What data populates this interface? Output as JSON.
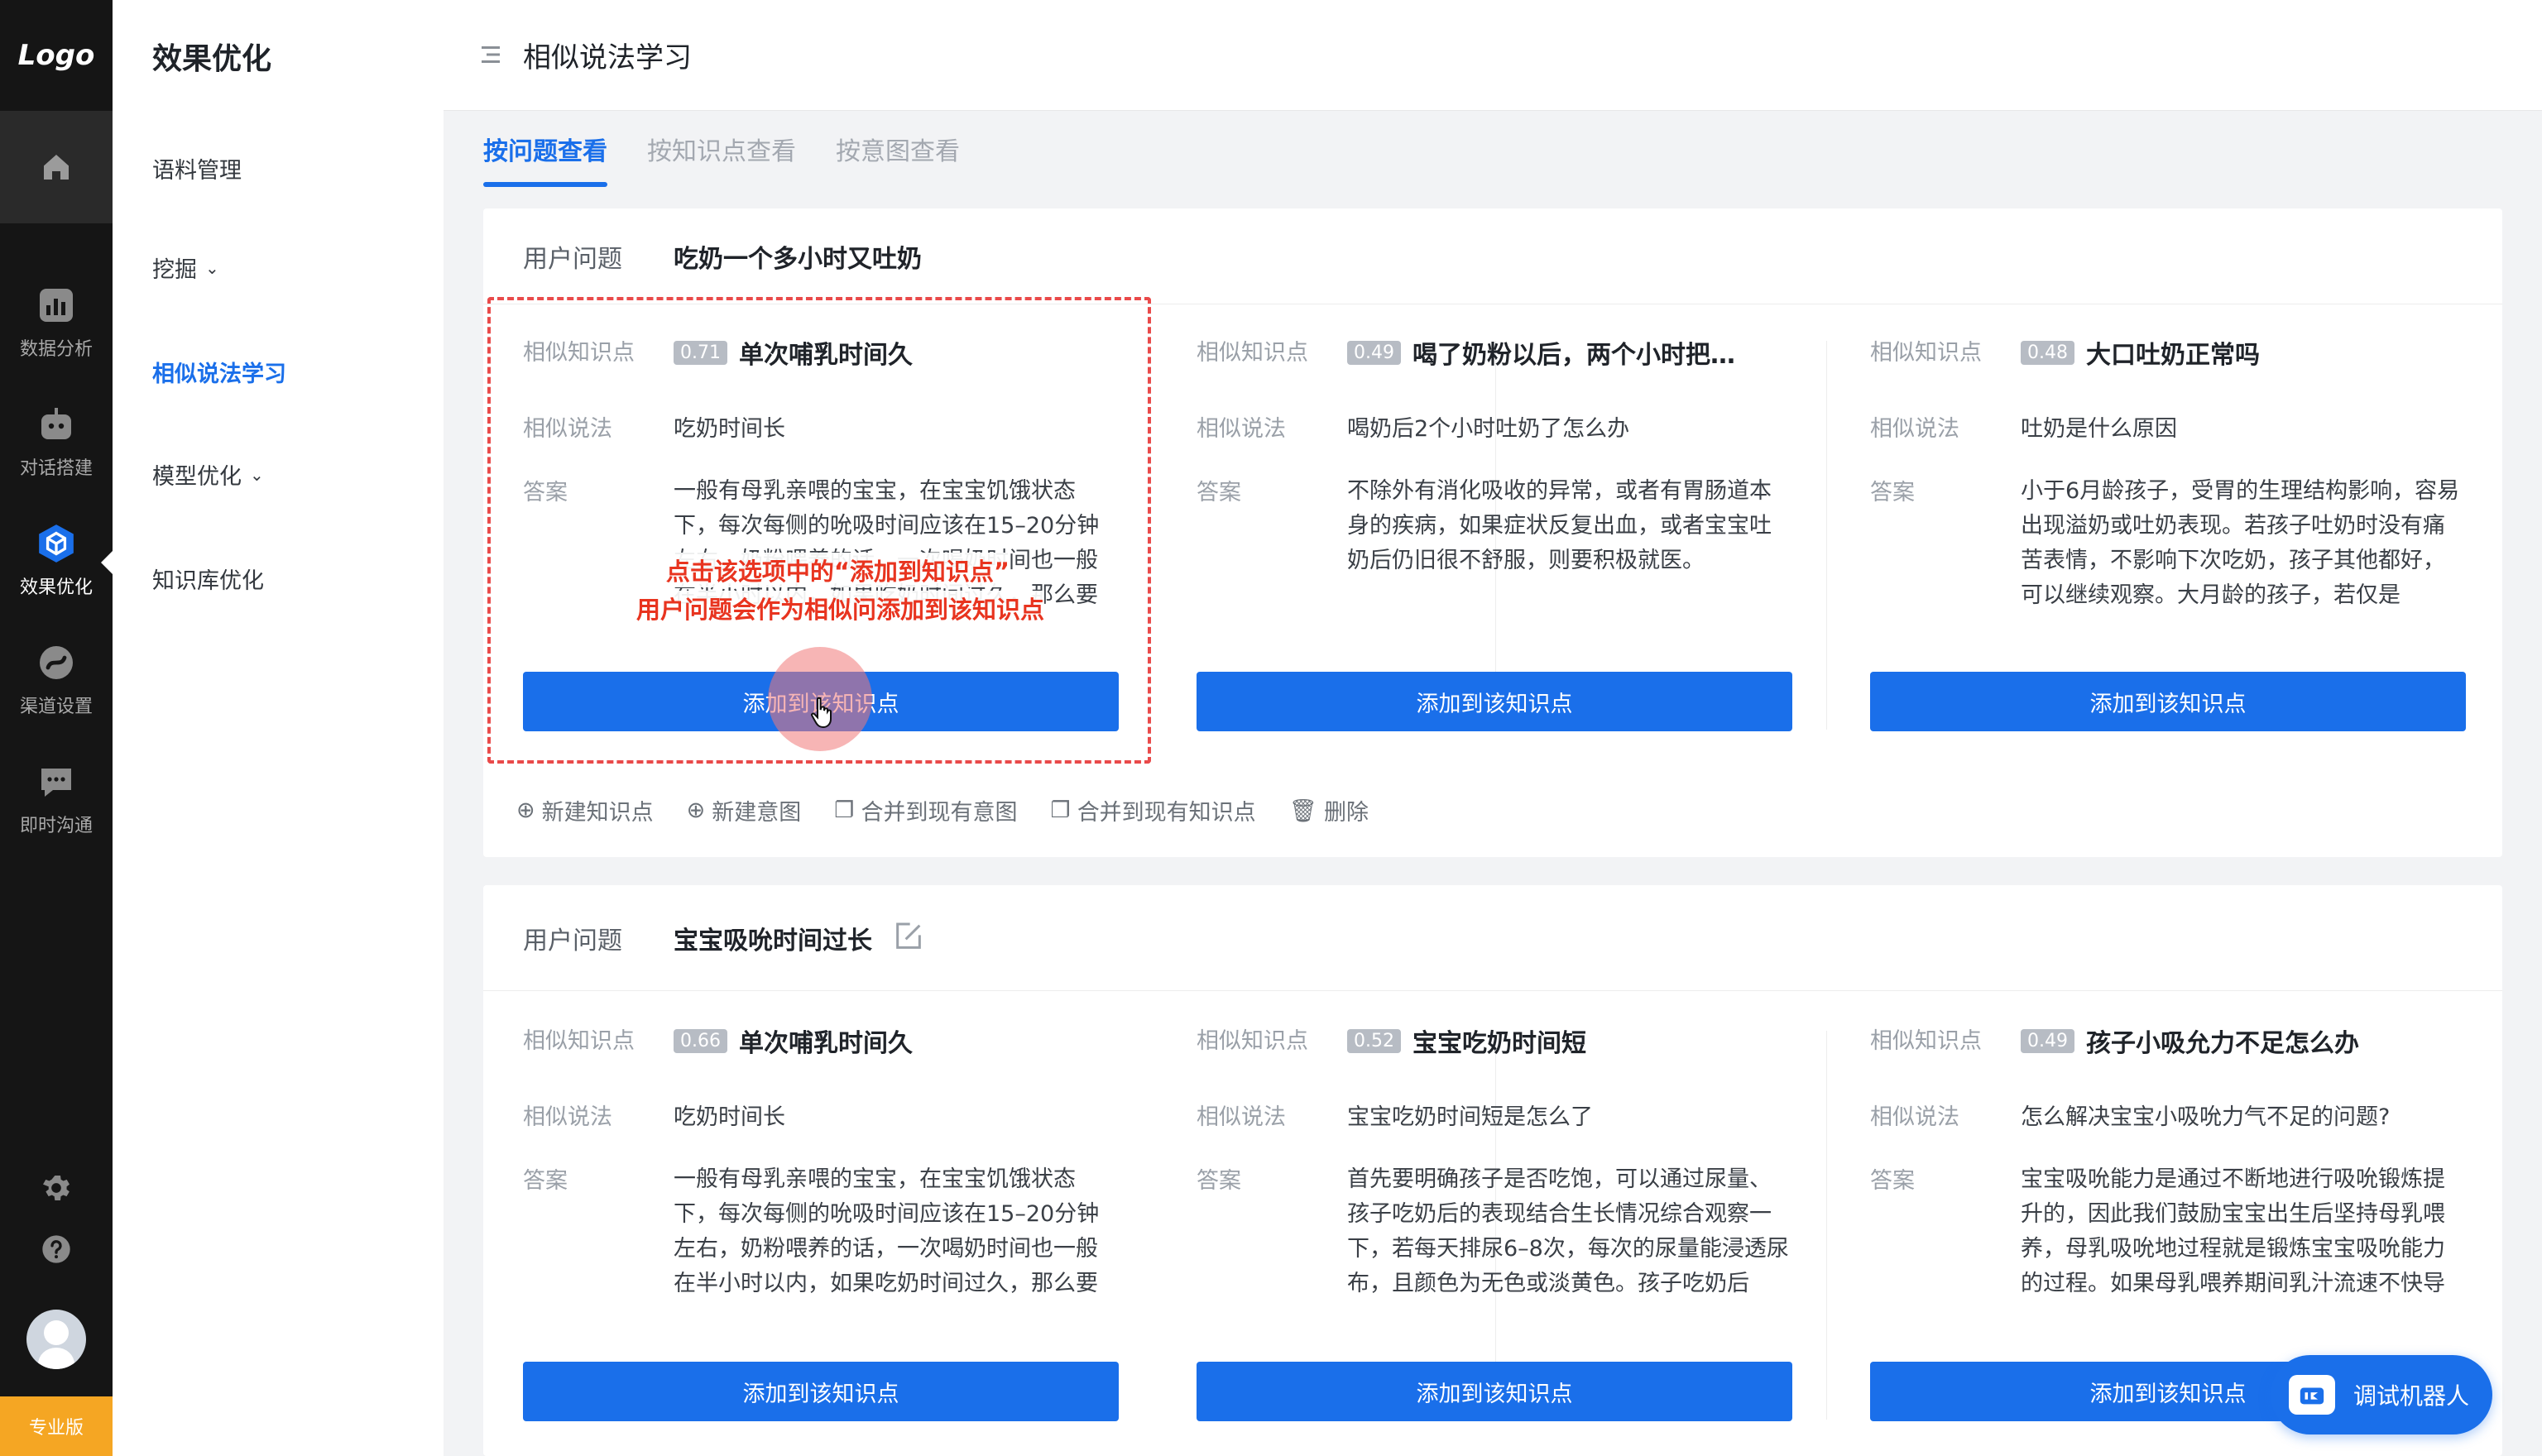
{
  "rail": {
    "logo": "Logo",
    "items": [
      {
        "label": "数据分析",
        "icon": "bar-chart-icon"
      },
      {
        "label": "对话搭建",
        "icon": "robot-icon"
      },
      {
        "label": "效果优化",
        "icon": "cube-icon"
      },
      {
        "label": "渠道设置",
        "icon": "channel-icon"
      },
      {
        "label": "即时沟通",
        "icon": "chat-icon"
      }
    ],
    "badge": "专业版"
  },
  "subnav": {
    "title": "效果优化",
    "items": [
      "语料管理",
      "挖掘",
      "相似说法学习",
      "模型优化",
      "知识库优化"
    ]
  },
  "header": {
    "title": "相似说法学习"
  },
  "tabs": [
    "按问题查看",
    "按知识点查看",
    "按意图查看"
  ],
  "labels": {
    "user_question": "用户问题",
    "similar_kp": "相似知识点",
    "similar_phrase": "相似说法",
    "answer": "答案",
    "add_button": "添加到该知识点"
  },
  "actions": [
    "新建知识点",
    "新建意图",
    "合并到现有意图",
    "合并到现有知识点",
    "删除"
  ],
  "cards": [
    {
      "question": "吃奶一个多小时又吐奶",
      "columns": [
        {
          "score": "0.71",
          "kp": "单次哺乳时间久",
          "phrase": "吃奶时间长",
          "answer": "一般有母乳亲喂的宝宝，在宝宝饥饿状态下，每次每侧的吮吸时间应该在15–20分钟左右，奶粉喂养的话，一次喝奶时间也一般在半小时以内，如果吃奶时间过久，那么要"
        },
        {
          "score": "0.49",
          "kp": "喝了奶粉以后，两个小时把…",
          "phrase": "喝奶后2个小时吐奶了怎么办",
          "answer": "不除外有消化吸收的异常，或者有胃肠道本身的疾病，如果症状反复出血，或者宝宝吐奶后仍旧很不舒服，则要积极就医。"
        },
        {
          "score": "0.48",
          "kp": "大口吐奶正常吗",
          "phrase": "吐奶是什么原因",
          "answer": "小于6月龄孩子，受胃的生理结构影响，容易出现溢奶或吐奶表现。若孩子吐奶时没有痛苦表情，不影响下次吃奶，孩子其他都好，可以继续观察。大月龄的孩子，若仅是"
        }
      ]
    },
    {
      "question": "宝宝吸吮时间过长",
      "columns": [
        {
          "score": "0.66",
          "kp": "单次哺乳时间久",
          "phrase": "吃奶时间长",
          "answer": "一般有母乳亲喂的宝宝，在宝宝饥饿状态下，每次每侧的吮吸时间应该在15–20分钟左右，奶粉喂养的话，一次喝奶时间也一般在半小时以内，如果吃奶时间过久，那么要"
        },
        {
          "score": "0.52",
          "kp": "宝宝吃奶时间短",
          "phrase": "宝宝吃奶时间短是怎么了",
          "answer": "首先要明确孩子是否吃饱，可以通过尿量、孩子吃奶后的表现结合生长情况综合观察一下，若每天排尿6–8次，每次的尿量能浸透尿布，且颜色为无色或淡黄色。孩子吃奶后"
        },
        {
          "score": "0.49",
          "kp": "孩子小吸允力不足怎么办",
          "phrase": "怎么解决宝宝小吸吮力气不足的问题?",
          "answer": "宝宝吸吮能力是通过不断地进行吸吮锻炼提升的，因此我们鼓励宝宝出生后坚持母乳喂养，母乳吸吮地过程就是锻炼宝宝吸吮能力的过程。如果母乳喂养期间乳汁流速不快导"
        }
      ]
    }
  ],
  "tip": {
    "line1": "点击该选项中的“添加到知识点”",
    "line2": "用户问题会作为相似问添加到该知识点"
  },
  "robot": {
    "label": "调试机器人"
  },
  "colors": {
    "primary": "#1a6fea",
    "tip": "#e8341f",
    "rail": "#151515"
  }
}
